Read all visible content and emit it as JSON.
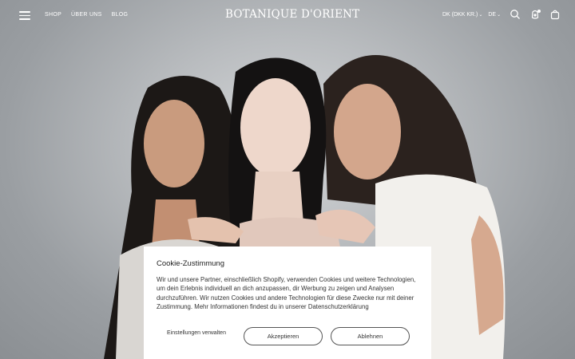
{
  "header": {
    "nav": [
      "SHOP",
      "ÜBER UNS",
      "BLOG"
    ],
    "logo": "BOTANIQUE D'ORIENT",
    "currency": "DK (DKK KR.)",
    "language": "DE"
  },
  "icons": {
    "menu": "hamburger-menu-icon",
    "search": "search-icon",
    "account": "user-icon",
    "cart": "shopping-bag-icon"
  },
  "cookie": {
    "title": "Cookie-Zustimmung",
    "text": "Wir und unsere Partner, einschließlich Shopify, verwenden Cookies und weitere Technologien, um dein Erlebnis individuell an dich anzupassen, dir Werbung zu zeigen und Analysen durchzuführen. Wir nutzen Cookies und andere Technologien für diese Zwecke nur mit deiner Zustimmung. Mehr Informationen findest du in unserer Datenschutzerklärung",
    "settings_label": "Einstellungen verwalten",
    "accept_label": "Akzeptieren",
    "decline_label": "Ablehnen"
  },
  "colors": {
    "header_text": "#ffffff",
    "dialog_bg": "#ffffff",
    "button_border": "#555555"
  }
}
